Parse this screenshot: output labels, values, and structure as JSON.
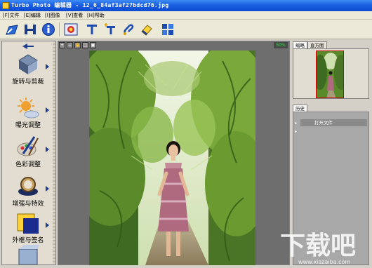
{
  "window": {
    "title": "Turbo Photo 编辑器  - 12_6_84af3af27bdcd76.jpg"
  },
  "menu": [
    {
      "label": "[F]文件"
    },
    {
      "label": "[E]编辑"
    },
    {
      "label": "[I]图像"
    },
    {
      "label": "[V]查看"
    },
    {
      "label": "[H]帮助"
    }
  ],
  "toolbar": {
    "buttons": [
      {
        "name": "open-icon"
      },
      {
        "name": "save-icon"
      },
      {
        "name": "info-icon"
      },
      {
        "name": "photo-icon"
      },
      {
        "name": "text-tool-icon"
      },
      {
        "name": "text-add-icon"
      },
      {
        "name": "brush-icon"
      },
      {
        "name": "eraser-icon"
      },
      {
        "name": "layout-icon"
      }
    ]
  },
  "left_panel": {
    "items": [
      {
        "label": "旋转与剪裁",
        "icon": "rotate-crop-icon"
      },
      {
        "label": "曝光调整",
        "icon": "exposure-icon"
      },
      {
        "label": "色彩调整",
        "icon": "color-adjust-icon"
      },
      {
        "label": "增强与特效",
        "icon": "enhance-effects-icon"
      },
      {
        "label": "外框与签名",
        "icon": "frame-signature-icon"
      }
    ]
  },
  "view": {
    "zoom": "50%"
  },
  "right_panel": {
    "tabs": [
      "缩略",
      "直方图"
    ],
    "history_tab": "历史",
    "history": [
      "打开文件"
    ]
  },
  "watermark": {
    "big": "下载吧",
    "small": "www.xiazaiba.com"
  },
  "colors": {
    "titlebar": "#0c4ad0",
    "canvas": "#6e6e6e",
    "history_bg": "#a8a8a8"
  }
}
